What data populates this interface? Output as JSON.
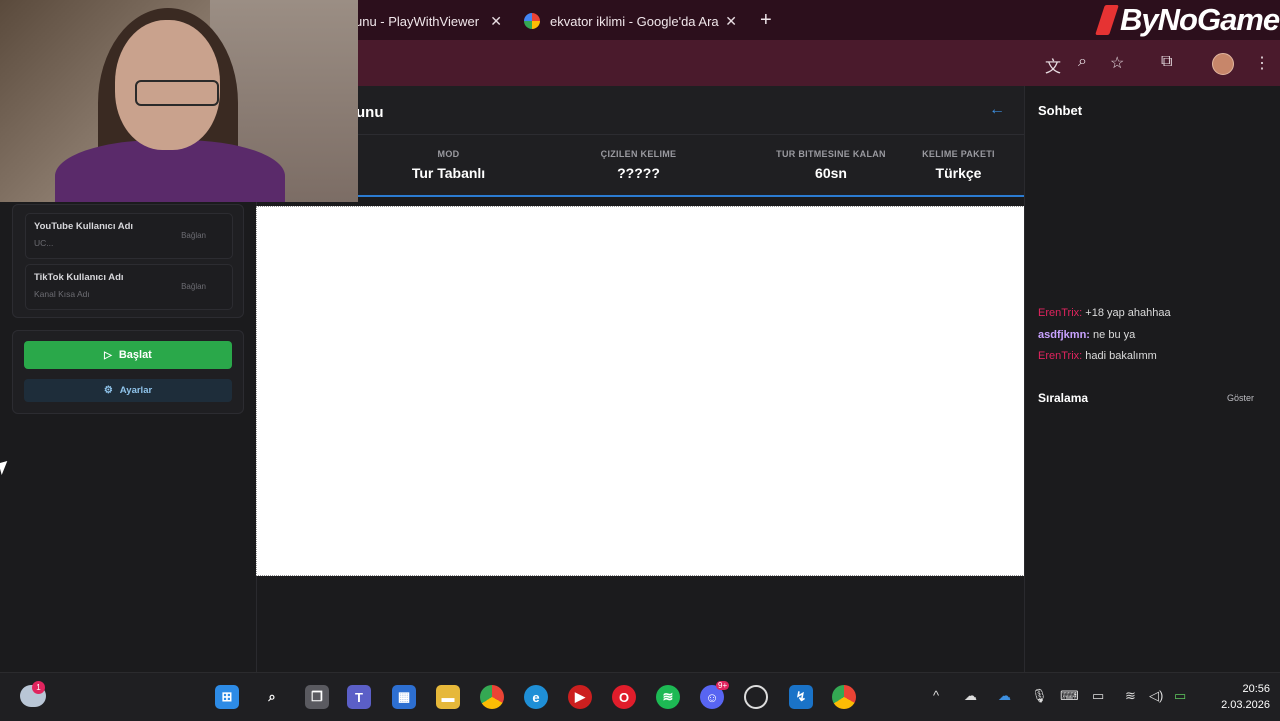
{
  "browser": {
    "tabs": [
      {
        "title": "unu - PlayWithViewer",
        "active": true
      },
      {
        "title": "ekvator iklimi - Google'da Ara",
        "active": false
      }
    ],
    "new_tab": "+",
    "close_glyph": "✕",
    "brand_logo": "ByNoGame"
  },
  "toolbar_icons": [
    "translate-icon",
    "zoom-icon",
    "star-icon",
    "extensions-icon",
    "profile-avatar",
    "menu-icon"
  ],
  "left_panel": {
    "fields": [
      {
        "label": "YouTube Kullanıcı Adı",
        "placeholder": "UC...",
        "action": "Bağlan"
      },
      {
        "label": "TikTok Kullanıcı Adı",
        "placeholder": "Kanal Kısa Adı",
        "action": "Bağlan"
      }
    ],
    "start_button": "Başlat",
    "settings_button": "Ayarlar"
  },
  "game": {
    "title": "unu",
    "stats": [
      {
        "key": "MOD",
        "value": "Tur Tabanlı"
      },
      {
        "key": "ÇIZILEN KELIME",
        "value": "?????"
      },
      {
        "key": "TUR BITMESINE KALAN",
        "value": "60sn"
      },
      {
        "key": "KELIME PAKETI",
        "value": "Türkçe"
      }
    ]
  },
  "chat": {
    "title": "Sohbet",
    "messages": [
      {
        "user": "ErenTrix:",
        "text": "+18 yap ahahhaa"
      },
      {
        "user": "asdfjkmn:",
        "text": "ne bu ya"
      },
      {
        "user": "ErenTrix:",
        "text": "hadi bakalımm"
      }
    ]
  },
  "ranking": {
    "title": "Sıralama",
    "show": "Göster"
  },
  "taskbar": {
    "weather_badge": "1",
    "discord_badge": "9+",
    "time": "20:56",
    "date": "2.03.2026"
  },
  "colors": {
    "tabstrip": "#2c0f1c",
    "toolbar": "#4a1a2c",
    "start_button": "#2aa84a",
    "stats_underline": "#2b7bd1",
    "chat_user_red": "#e0245e",
    "chat_user_purple": "#c8a2ff"
  }
}
